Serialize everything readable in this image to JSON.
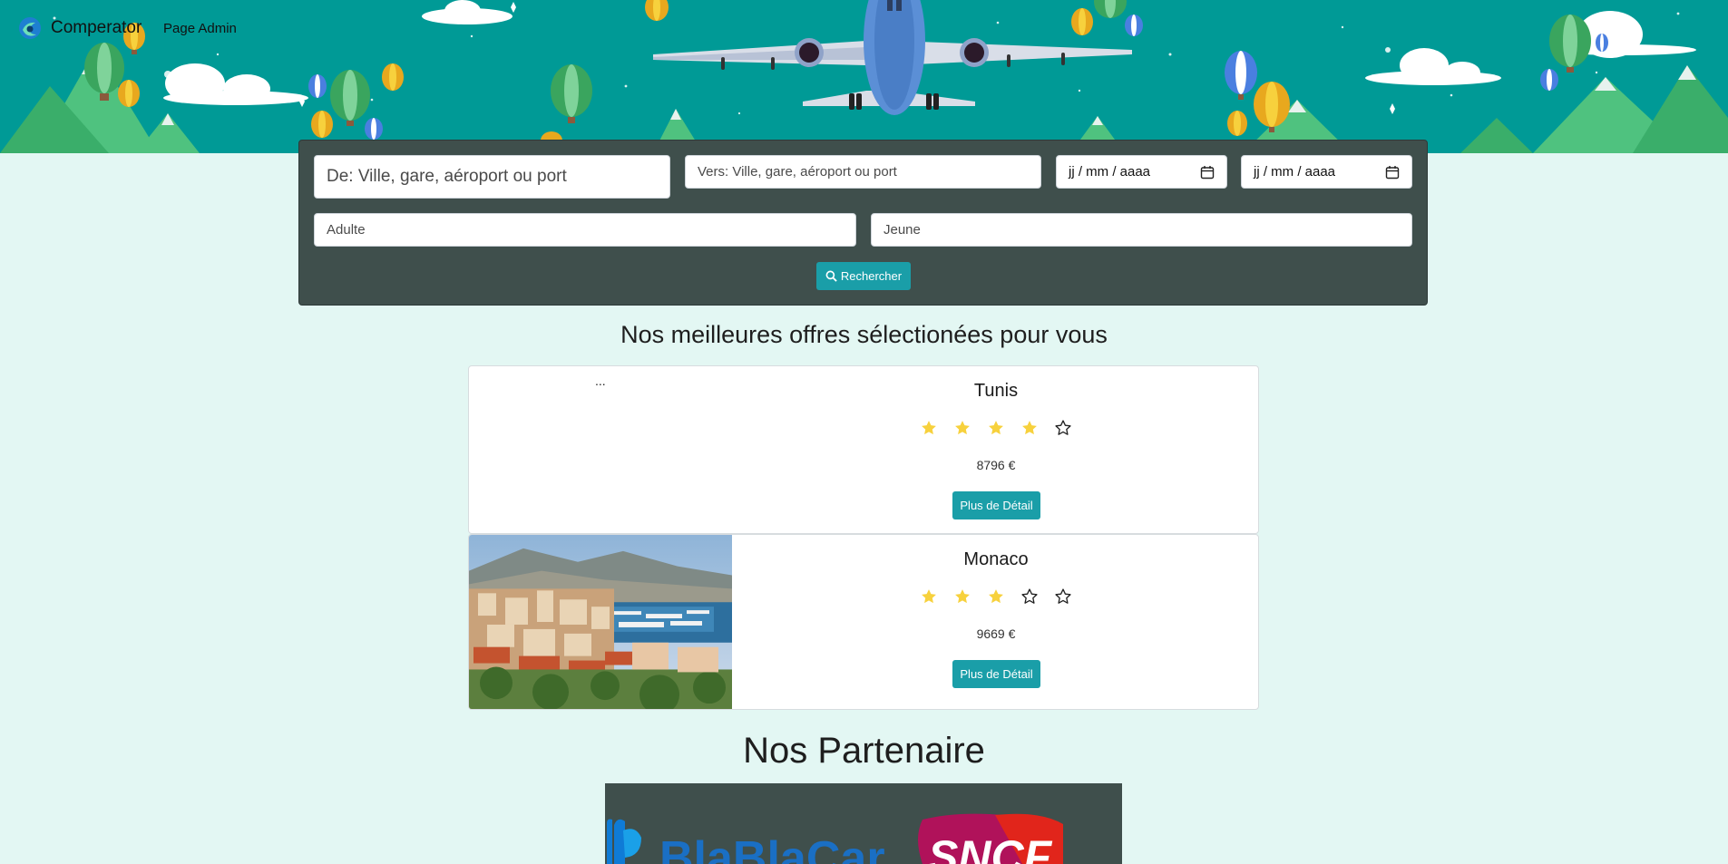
{
  "header": {
    "brand_name": "Comperator",
    "nav_admin": "Page Admin"
  },
  "search": {
    "from_placeholder": "De: Ville, gare, aéroport ou port",
    "to_placeholder": "Vers: Ville, gare, aéroport ou port",
    "date_depart_placeholder": "jj / mm / aaaa",
    "date_return_placeholder": "jj / mm / aaaa",
    "adult_placeholder": "Adulte",
    "young_placeholder": "Jeune",
    "button_label": "Rechercher"
  },
  "offers": {
    "title": "Nos meilleures offres sélectionées pour vous",
    "items": [
      {
        "city": "Tunis",
        "rating": 4,
        "max_rating": 5,
        "price": "8796 €",
        "button": "Plus de Détail",
        "image_alt": "..."
      },
      {
        "city": "Monaco",
        "rating": 3,
        "max_rating": 5,
        "price": "9669 €",
        "button": "Plus de Détail"
      }
    ]
  },
  "partners": {
    "title": "Nos Partenaire",
    "logos": [
      "BlaBlaCar",
      "SNCF"
    ]
  },
  "colors": {
    "hero_bg": "#009a96",
    "page_bg": "#e3f7f3",
    "panel_bg": "#3f4f4c",
    "accent": "#1a9ea8",
    "star_filled": "#f7d13d"
  }
}
